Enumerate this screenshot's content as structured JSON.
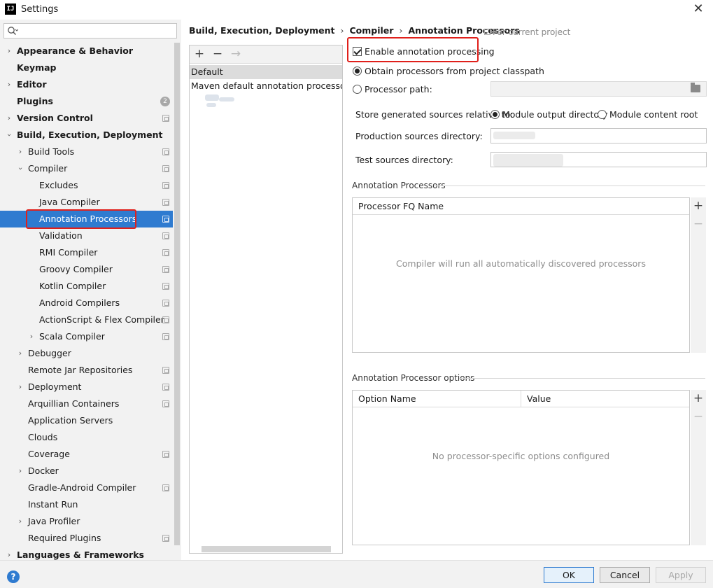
{
  "window": {
    "title": "Settings",
    "app_icon_text": "IJ"
  },
  "sidebar": {
    "search_placeholder": "",
    "items": [
      {
        "label": "Appearance & Behavior"
      },
      {
        "label": "Keymap"
      },
      {
        "label": "Editor"
      },
      {
        "label": "Plugins",
        "badge": "2"
      },
      {
        "label": "Version Control"
      },
      {
        "label": "Build, Execution, Deployment"
      },
      {
        "label": "Build Tools"
      },
      {
        "label": "Compiler"
      },
      {
        "label": "Excludes"
      },
      {
        "label": "Java Compiler"
      },
      {
        "label": "Annotation Processors"
      },
      {
        "label": "Validation"
      },
      {
        "label": "RMI Compiler"
      },
      {
        "label": "Groovy Compiler"
      },
      {
        "label": "Kotlin Compiler"
      },
      {
        "label": "Android Compilers"
      },
      {
        "label": "ActionScript & Flex Compiler"
      },
      {
        "label": "Scala Compiler"
      },
      {
        "label": "Debugger"
      },
      {
        "label": "Remote Jar Repositories"
      },
      {
        "label": "Deployment"
      },
      {
        "label": "Arquillian Containers"
      },
      {
        "label": "Application Servers"
      },
      {
        "label": "Clouds"
      },
      {
        "label": "Coverage"
      },
      {
        "label": "Docker"
      },
      {
        "label": "Gradle-Android Compiler"
      },
      {
        "label": "Instant Run"
      },
      {
        "label": "Java Profiler"
      },
      {
        "label": "Required Plugins"
      },
      {
        "label": "Languages & Frameworks"
      }
    ]
  },
  "breadcrumb": [
    "Build, Execution, Deployment",
    "Compiler",
    "Annotation Processors"
  ],
  "breadcrumb_sep": "›",
  "for_current_project": "For current project",
  "profiles": {
    "toolbar": {
      "add": "+",
      "remove": "−",
      "move": "→"
    },
    "items": [
      "Default",
      "Maven default annotation processors pro"
    ]
  },
  "settings": {
    "enable_label": "Enable annotation processing",
    "obtain_label": "Obtain processors from project classpath",
    "path_label": "Processor path:",
    "store_label": "Store generated sources relative to:",
    "module_output": "Module output directory",
    "module_content": "Module content root",
    "prod_label": "Production sources directory:",
    "test_label": "Test sources directory:"
  },
  "processors": {
    "section_title": "Annotation Processors",
    "column": "Processor FQ Name",
    "empty": "Compiler will run all automatically discovered processors",
    "add": "+",
    "remove": "−"
  },
  "options": {
    "section_title": "Annotation Processor options",
    "col_name": "Option Name",
    "col_value": "Value",
    "empty": "No processor-specific options configured",
    "add": "+",
    "remove": "−"
  },
  "footer": {
    "help": "?",
    "ok": "OK",
    "cancel": "Cancel",
    "apply": "Apply"
  }
}
